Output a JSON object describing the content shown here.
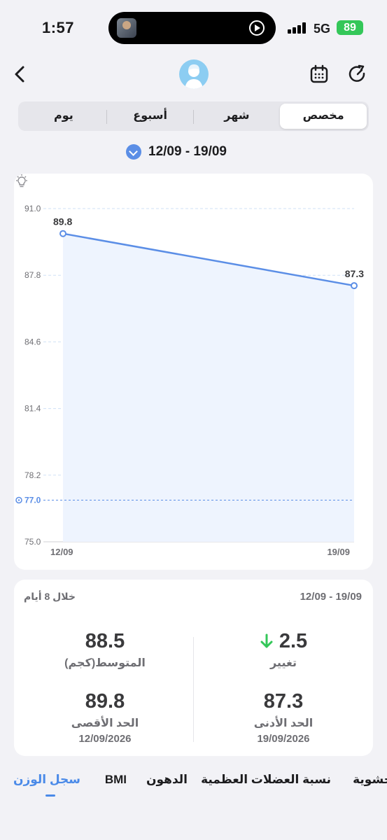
{
  "status_bar": {
    "time": "1:57",
    "network": "5G",
    "battery": "89"
  },
  "tabs_range": [
    "مخصص",
    "شهر",
    "أسبوع",
    "يوم"
  ],
  "date_range": "12/09 - 19/09",
  "chart_data": {
    "type": "line",
    "x": [
      "12/09",
      "19/09"
    ],
    "series": [
      {
        "values": [
          89.8,
          87.3
        ]
      }
    ],
    "data_labels": [
      "89.8",
      "87.3"
    ],
    "yticks": [
      "91.0",
      "87.8",
      "84.6",
      "81.4",
      "78.2",
      "75.0"
    ],
    "ylim": [
      75.0,
      91.0
    ],
    "target_line": {
      "value": 77.0,
      "label": "77.0"
    },
    "grid": true,
    "colors": {
      "line": "#5b8ee6",
      "fill": "#eef4fe",
      "grid": "#cfe0f5"
    }
  },
  "summary": {
    "period": "خلال 8 أيام",
    "range": "12/09 - 19/09",
    "change": {
      "value": "2.5",
      "label": "تغيير"
    },
    "average": {
      "value": "88.5",
      "label": "المتوسط(كجم)"
    },
    "min": {
      "value": "87.3",
      "label": "الحد الأدنى",
      "date": "19/09/2026"
    },
    "max": {
      "value": "89.8",
      "label": "الحد الأقصى",
      "date": "12/09/2026"
    }
  },
  "bottom_tabs": [
    "سجل الوزن",
    "BMI",
    "الدهون",
    "نسبة العضلات العظمية",
    "حشوية"
  ],
  "icons": [
    "back-icon",
    "avatar-icon",
    "calendar-icon",
    "refresh-icon",
    "chevron-down-icon",
    "bulb-icon",
    "target-icon",
    "arrow-down-icon"
  ]
}
